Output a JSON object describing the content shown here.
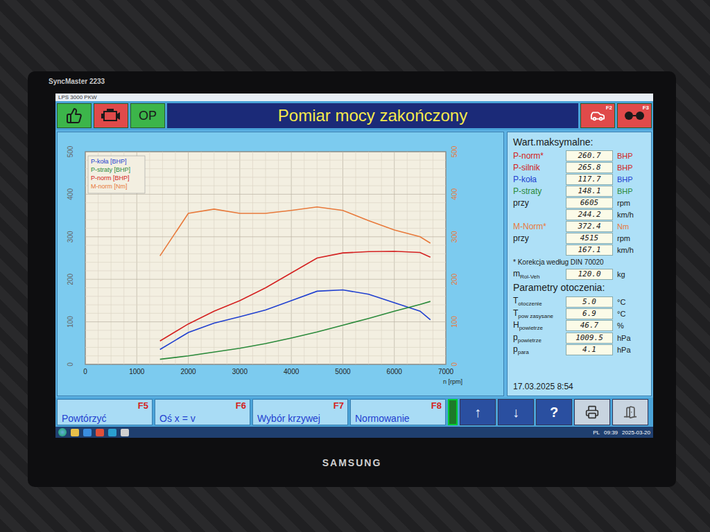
{
  "monitor": {
    "model": "SyncMaster 2233",
    "brand": "SAMSUNG"
  },
  "window": {
    "title": "LPS 3000 PKW"
  },
  "header": {
    "status": "Pomiar mocy zakończony",
    "mode_button": "OP",
    "keys": [
      "F2",
      "F3"
    ]
  },
  "chart": {
    "y_ticks": [
      "0",
      "100",
      "200",
      "300",
      "400",
      "500"
    ],
    "y2_ticks": [
      "0",
      "100",
      "200",
      "300",
      "400",
      "500"
    ],
    "x_ticks": [
      "0",
      "1000",
      "2000",
      "3000",
      "4000",
      "5000",
      "6000",
      "7000"
    ],
    "x_label": "n [rpm]",
    "rpm": [
      1450,
      2000,
      2500,
      3000,
      3500,
      4000,
      4500,
      5000,
      5500,
      6000,
      6500,
      6700
    ],
    "series": [
      {
        "label": "P-koła [BHP]",
        "color": "#1f3fd0",
        "values": [
          35,
          75,
          97,
          112,
          128,
          150,
          172,
          175,
          165,
          145,
          125,
          105
        ]
      },
      {
        "label": "P-straty [BHP]",
        "color": "#2a8a3a",
        "values": [
          12,
          20,
          29,
          38,
          49,
          62,
          76,
          92,
          108,
          125,
          141,
          148
        ]
      },
      {
        "label": "P-norm [BHP]",
        "color": "#d42020",
        "values": [
          55,
          95,
          125,
          150,
          180,
          215,
          250,
          262,
          265,
          266,
          263,
          252
        ]
      },
      {
        "label": "M-norm [Nm]",
        "color": "#e8793a",
        "values": [
          255,
          355,
          365,
          355,
          355,
          362,
          370,
          362,
          338,
          316,
          300,
          285
        ]
      }
    ]
  },
  "max_values": {
    "title": "Wart.maksymalne:",
    "rows": [
      {
        "label": "P-norm*",
        "value": "260.7",
        "unit": "BHP",
        "color": "#d42020"
      },
      {
        "label": "P-silnik",
        "value": "265.8",
        "unit": "BHP",
        "color": "#d42020"
      },
      {
        "label": "P-koła",
        "value": "117.7",
        "unit": "BHP",
        "color": "#1f3fd0"
      },
      {
        "label": "P-straty",
        "value": "148.1",
        "unit": "BHP",
        "color": "#2a8a3a"
      },
      {
        "label": "przy",
        "value": "6605",
        "unit": "rpm",
        "color": "#1a1a1a"
      },
      {
        "label": "",
        "value": "244.2",
        "unit": "km/h",
        "color": "#1a1a1a"
      },
      {
        "label": "M-Norm*",
        "value": "372.4",
        "unit": "Nm",
        "color": "#e8793a"
      },
      {
        "label": "przy",
        "value": "4515",
        "unit": "rpm",
        "color": "#1a1a1a"
      },
      {
        "label": "",
        "value": "167.1",
        "unit": "km/h",
        "color": "#1a1a1a"
      }
    ],
    "note": "* Korekcja według DIN 70020",
    "mass": {
      "label": "m",
      "sub": "Rol-Veh",
      "value": "120.0",
      "unit": "kg"
    }
  },
  "ambient": {
    "title": "Parametry otoczenia:",
    "rows": [
      {
        "label": "T",
        "sub": "otoczenie",
        "value": "5.0",
        "unit": "°C"
      },
      {
        "label": "T",
        "sub": "pow zasysane",
        "value": "6.9",
        "unit": "°C"
      },
      {
        "label": "H",
        "sub": "powietrze",
        "value": "46.7",
        "unit": "%"
      },
      {
        "label": "p",
        "sub": "powietrze",
        "value": "1009.5",
        "unit": "hPa"
      },
      {
        "label": "p",
        "sub": "para",
        "value": "4.1",
        "unit": "hPa"
      }
    ]
  },
  "timestamp": "17.03.2025 8:54",
  "function_keys": [
    {
      "label": "Powtórzyć",
      "key": "F5"
    },
    {
      "label": "Oś x = v",
      "key": "F6"
    },
    {
      "label": "Wybór krzywej",
      "key": "F7"
    },
    {
      "label": "Normowanie",
      "key": "F8"
    }
  ],
  "tools": [
    {
      "kind": "arrow",
      "label": "↑"
    },
    {
      "kind": "arrow",
      "label": "↓"
    },
    {
      "kind": "help",
      "label": "?"
    },
    {
      "kind": "printer",
      "label": ""
    },
    {
      "kind": "exit",
      "label": ""
    }
  ],
  "taskbar": {
    "language": "PL",
    "time": "09:39",
    "date": "2025-03-20"
  }
}
